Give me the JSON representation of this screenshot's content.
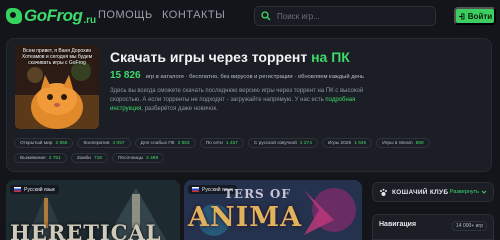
{
  "header": {
    "logo_text": "GoFrog",
    "logo_suffix": ".ru",
    "nav": {
      "help": "ПОМОЩЬ",
      "contacts": "КОНТАКТЫ"
    },
    "search_placeholder": "Поиск игр...",
    "login_label": "Войти"
  },
  "hero": {
    "image_caption": "Всем привет, я Ваня Дорохин Хотеамов и сегодня мы будем скачивать игры с GoFrog",
    "title_main": "Скачать игры через торрент ",
    "title_accent": "на ПК",
    "count": "15 826",
    "stats_text": "игр в каталоге · бесплатно, без вирусов и регистрации · обновляем каждый день",
    "desc_1": "Здесь вы всегда сможете скачать последнюю версию игры через торрент на ПК с высокой скоростью. А если торренты не подходят - загружайте напрямую. У нас есть ",
    "desc_link": "подробная инструкция",
    "desc_2": ", разберётся даже новичок."
  },
  "tags": [
    {
      "label": "Открытый мир",
      "count": "2 856"
    },
    {
      "label": "Кооператив",
      "count": "4 057"
    },
    {
      "label": "Для слабых ПК",
      "count": "3 863"
    },
    {
      "label": "По сети",
      "count": "1 457"
    },
    {
      "label": "С русской озвучкой",
      "count": "2 274"
    },
    {
      "label": "Игры 2026",
      "count": "1 645"
    },
    {
      "label": "Игры в Steam",
      "count": "888"
    },
    {
      "label": "Выживание",
      "count": "2 751"
    },
    {
      "label": "Зомби",
      "count": "718"
    },
    {
      "label": "Песочницы",
      "count": "2 488"
    }
  ],
  "cards": [
    {
      "badge": "Русский язык",
      "title": "HERETICAL"
    },
    {
      "badge": "Русский язык",
      "title_top": "TERS OF",
      "title": "ANIMA"
    }
  ],
  "sidebar": {
    "club_label": "КОШАЧИЙ КЛУБ",
    "club_expand": "Развернуть",
    "nav_label": "Навигация",
    "nav_count": "14 000+ игр"
  },
  "colors": {
    "accent": "#3fd96a",
    "background": "#13151b",
    "panel": "#1b1e25"
  }
}
